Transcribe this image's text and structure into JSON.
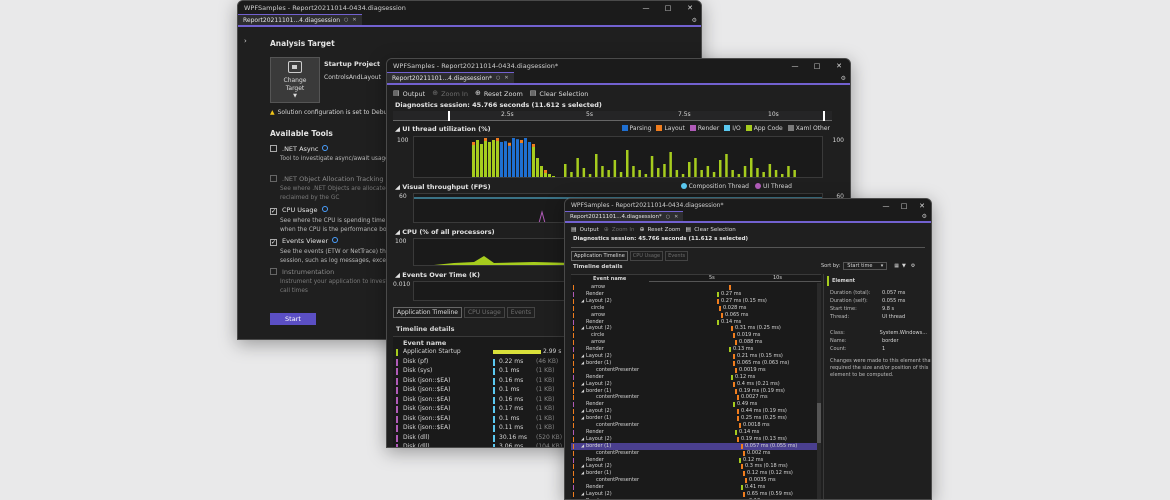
{
  "accent": "#7261d0",
  "window1": {
    "title": "WPFSamples - Report20211014-0434.diagsession",
    "tab": "Report20211101...4.diagsession",
    "analysis_target": "Analysis Target",
    "startup_project": "Startup Project",
    "project_name": "ControlsAndLayout",
    "change_target": "Change Target",
    "warning": "Solution configuration is set to Debug.",
    "available_tools": "Available Tools",
    "tools": [
      {
        "name": ".NET Async",
        "checked": false,
        "desc": [
          "Tool to investigate async/await usage i"
        ]
      },
      {
        "name": ".NET Object Allocation Tracking",
        "checked": false,
        "desc": [
          "See where .NET Objects are allocated a",
          "reclaimed by the GC"
        ]
      },
      {
        "name": "CPU Usage",
        "checked": true,
        "desc": [
          "See where the CPU is spending time ex",
          "when the CPU is the performance bott"
        ]
      },
      {
        "name": "Events Viewer",
        "checked": true,
        "desc": [
          "See the events (ETW or NetTrace) that",
          "session, such as log messages, excepti"
        ]
      },
      {
        "name": "Instrumentation",
        "checked": false,
        "desc": [
          "Instrument your application to investig",
          "call times"
        ]
      }
    ],
    "start_button": "Start"
  },
  "window2": {
    "title": "WPFSamples - Report20211014-0434.diagsession*",
    "tab": "Report20211101...4.diagsession*",
    "toolbar": {
      "output": "Output",
      "zoom_in": "Zoom In",
      "reset_zoom": "Reset Zoom",
      "clear_selection": "Clear Selection"
    },
    "session": "Diagnostics session: 45.766 seconds (11.612 s selected)",
    "ruler_ticks": [
      "2.5s",
      "5s",
      "7.5s",
      "10s"
    ],
    "ui_thread_title": "UI thread utilization (%)",
    "ui_legend": [
      {
        "name": "Parsing",
        "color": "#1f6fd1"
      },
      {
        "name": "Layout",
        "color": "#f07d1e"
      },
      {
        "name": "Render",
        "color": "#b05bb8"
      },
      {
        "name": "I/O",
        "color": "#5bc9f0"
      },
      {
        "name": "App Code",
        "color": "#a6cc1e"
      },
      {
        "name": "Xaml Other",
        "color": "#7b7b7b"
      }
    ],
    "ui_axis": "100",
    "visual_title": "Visual throughput (FPS)",
    "visual_legend": [
      {
        "name": "Composition Thread",
        "color": "#5bc9f0"
      },
      {
        "name": "UI Thread",
        "color": "#b05bb8"
      }
    ],
    "visual_axis": "60",
    "cpu_title": "CPU (% of all processors)",
    "cpu_axis": "100",
    "events_title": "Events Over Time (K)",
    "events_axis": "0.010",
    "bottom_tabs": [
      "Application Timeline",
      "CPU Usage",
      "Events"
    ],
    "timeline_details": "Timeline details",
    "event_header": "Event name",
    "events": [
      {
        "name": "Application Startup",
        "dur": "2.99 s",
        "sub": ""
      },
      {
        "name": "Disk (pf)",
        "dur": "0.22 ms",
        "sub": "(46 KB)"
      },
      {
        "name": "Disk (sys)",
        "dur": "0.1 ms",
        "sub": "(1 KB)"
      },
      {
        "name": "Disk (json::$EA)",
        "dur": "0.16 ms",
        "sub": "(1 KB)"
      },
      {
        "name": "Disk (json::$EA)",
        "dur": "0.1 ms",
        "sub": "(1 KB)"
      },
      {
        "name": "Disk (json::$EA)",
        "dur": "0.16 ms",
        "sub": "(1 KB)"
      },
      {
        "name": "Disk (json::$EA)",
        "dur": "0.17 ms",
        "sub": "(1 KB)"
      },
      {
        "name": "Disk (json::$EA)",
        "dur": "0.1 ms",
        "sub": "(1 KB)"
      },
      {
        "name": "Disk (json::$EA)",
        "dur": "0.11 ms",
        "sub": "(1 KB)"
      },
      {
        "name": "Disk (dll)",
        "dur": "30.16 ms",
        "sub": "(520 KB)"
      },
      {
        "name": "Disk (dll)",
        "dur": "3.06 ms",
        "sub": "(104 KB)"
      }
    ]
  },
  "window3": {
    "title": "WPFSamples - Report20211014-0434.diagsession*",
    "tab": "Report20211101...4.diagsession*",
    "toolbar": {
      "output": "Output",
      "zoom_in": "Zoom In",
      "reset_zoom": "Reset Zoom",
      "clear_selection": "Clear Selection"
    },
    "session": "Diagnostics session: 45.766 seconds (11.612 s selected)",
    "bottom_tabs": [
      "Application Timeline",
      "CPU Usage",
      "Events"
    ],
    "timeline_details": "Timeline details",
    "sort_by_label": "Sort by:",
    "sort_by_value": "Start time",
    "ruler_ticks": [
      "5s",
      "10s"
    ],
    "event_header": "Event name",
    "rows": [
      {
        "name": "arrow",
        "dur": "",
        "indent": 2,
        "sel": false
      },
      {
        "name": "Render",
        "dur": "0.27 ms",
        "indent": 1,
        "sel": false
      },
      {
        "name": "Layout (2)",
        "dur": "0.27 ms (0.15 ms)",
        "indent": 1,
        "sel": false
      },
      {
        "name": "circle",
        "dur": "0.028 ms",
        "indent": 2,
        "sel": false
      },
      {
        "name": "arrow",
        "dur": "0.065 ms",
        "indent": 2,
        "sel": false
      },
      {
        "name": "Render",
        "dur": "0.14 ms",
        "indent": 1,
        "sel": false
      },
      {
        "name": "Layout (2)",
        "dur": "0.31 ms (0.25 ms)",
        "indent": 1,
        "sel": false
      },
      {
        "name": "circle",
        "dur": "0.019 ms",
        "indent": 2,
        "sel": false
      },
      {
        "name": "arrow",
        "dur": "0.088 ms",
        "indent": 2,
        "sel": false
      },
      {
        "name": "Render",
        "dur": "0.13 ms",
        "indent": 1,
        "sel": false
      },
      {
        "name": "Layout (2)",
        "dur": "0.21 ms (0.15 ms)",
        "indent": 1,
        "sel": false
      },
      {
        "name": "border (1)",
        "dur": "0.065 ms (0.063 ms)",
        "indent": 1,
        "sel": false
      },
      {
        "name": "contentPresenter",
        "dur": "0.0019 ms",
        "indent": 3,
        "sel": false
      },
      {
        "name": "Render",
        "dur": "0.12 ms",
        "indent": 1,
        "sel": false
      },
      {
        "name": "Layout (2)",
        "dur": "0.4 ms (0.21 ms)",
        "indent": 1,
        "sel": false
      },
      {
        "name": "border (1)",
        "dur": "0.19 ms (0.19 ms)",
        "indent": 1,
        "sel": false
      },
      {
        "name": "contentPresenter",
        "dur": "0.0027 ms",
        "indent": 3,
        "sel": false
      },
      {
        "name": "Render",
        "dur": "0.49 ms",
        "indent": 1,
        "sel": false
      },
      {
        "name": "Layout (2)",
        "dur": "0.44 ms (0.19 ms)",
        "indent": 1,
        "sel": false
      },
      {
        "name": "border (1)",
        "dur": "0.25 ms (0.25 ms)",
        "indent": 1,
        "sel": false
      },
      {
        "name": "contentPresenter",
        "dur": "0.0018 ms",
        "indent": 3,
        "sel": false
      },
      {
        "name": "Render",
        "dur": "0.14 ms",
        "indent": 1,
        "sel": false
      },
      {
        "name": "Layout (2)",
        "dur": "0.19 ms (0.13 ms)",
        "indent": 1,
        "sel": false
      },
      {
        "name": "border (1)",
        "dur": "0.057 ms (0.055 ms)",
        "indent": 1,
        "sel": true
      },
      {
        "name": "contentPresenter",
        "dur": "0.002 ms",
        "indent": 3,
        "sel": false
      },
      {
        "name": "Render",
        "dur": "0.12 ms",
        "indent": 1,
        "sel": false
      },
      {
        "name": "Layout (2)",
        "dur": "0.3 ms (0.18 ms)",
        "indent": 1,
        "sel": false
      },
      {
        "name": "border (1)",
        "dur": "0.12 ms (0.12 ms)",
        "indent": 1,
        "sel": false
      },
      {
        "name": "contentPresenter",
        "dur": "0.0035 ms",
        "indent": 3,
        "sel": false
      },
      {
        "name": "Render",
        "dur": "0.41 ms",
        "indent": 1,
        "sel": false
      },
      {
        "name": "Layout (2)",
        "dur": "0.65 ms (0.59 ms)",
        "indent": 1,
        "sel": false
      },
      {
        "name": "Render",
        "dur": "0.13 ms",
        "indent": 1,
        "sel": false
      }
    ],
    "props_header": "Element",
    "props": [
      {
        "k": "Duration (total):",
        "v": "0.057 ms"
      },
      {
        "k": "Duration (self):",
        "v": "0.055 ms"
      },
      {
        "k": "Start time:",
        "v": "9.8 s"
      },
      {
        "k": "Thread:",
        "v": "UI thread"
      },
      {
        "k": "",
        "v": ""
      },
      {
        "k": "Class:",
        "v": "System.Windows..."
      },
      {
        "k": "Name:",
        "v": "border"
      },
      {
        "k": "Count:",
        "v": "1"
      }
    ],
    "props_note": [
      "Changes were made to this element that",
      "required the size and/or position of this",
      "element to be computed."
    ]
  }
}
